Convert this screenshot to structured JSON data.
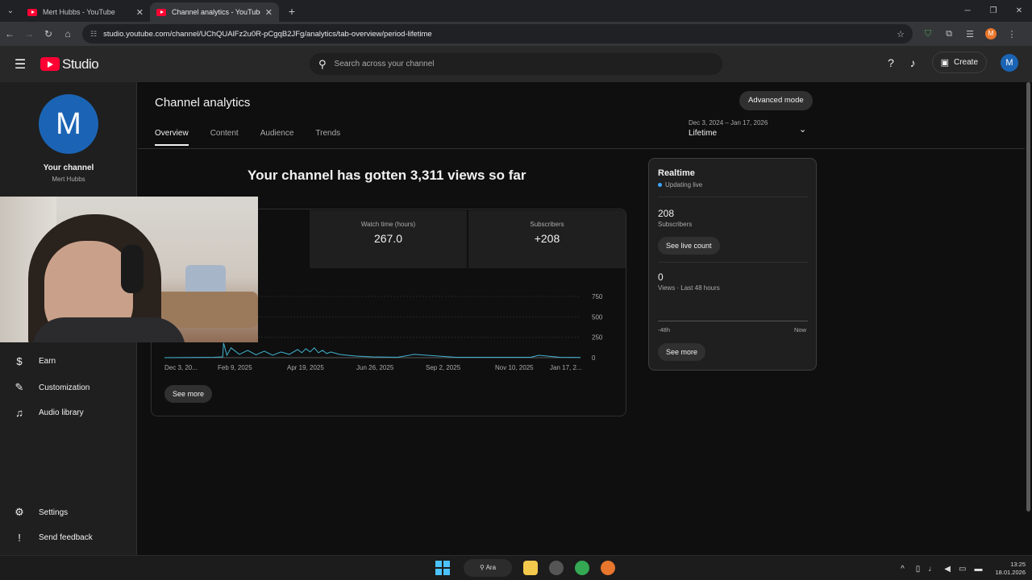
{
  "browser": {
    "tabs": [
      {
        "title": "Mert Hubbs - YouTube",
        "active": false
      },
      {
        "title": "Channel analytics - YouTube St",
        "active": true
      }
    ],
    "url": "studio.youtube.com/channel/UChQUAlFz2u0R-pCgqB2JFg/analytics/tab-overview/period-lifetime",
    "profile_initial": "M"
  },
  "header": {
    "logo_text": "Studio",
    "search_placeholder": "Search across your channel",
    "create_label": "Create",
    "avatar_initial": "M"
  },
  "sidebar": {
    "avatar_initial": "M",
    "your_channel_label": "Your channel",
    "channel_name": "Mert Hubbs",
    "items": [
      {
        "label": "Earn",
        "icon": "dollar-icon"
      },
      {
        "label": "Customization",
        "icon": "wand-icon"
      },
      {
        "label": "Audio library",
        "icon": "audio-library-icon"
      }
    ],
    "bottom_items": [
      {
        "label": "Settings",
        "icon": "gear-icon"
      },
      {
        "label": "Send feedback",
        "icon": "feedback-icon"
      }
    ]
  },
  "main": {
    "title": "Channel analytics",
    "advanced_mode_label": "Advanced mode",
    "tabs": [
      "Overview",
      "Content",
      "Audience",
      "Trends"
    ],
    "active_tab": "Overview",
    "date_range": "Dec 3, 2024 – Jan 17, 2026",
    "period": "Lifetime",
    "headline": "Your channel has gotten 3,311 views so far",
    "metrics": [
      {
        "label": "Watch time (hours)",
        "value": "267.0"
      },
      {
        "label": "Subscribers",
        "value": "+208"
      }
    ],
    "see_more_label": "See more"
  },
  "chart_data": {
    "type": "line",
    "x_tick_labels": [
      "Dec 3, 20...",
      "Feb 9, 2025",
      "Apr 19, 2025",
      "Jun 26, 2025",
      "Sep 2, 2025",
      "Nov 10, 2025",
      "Jan 17, 2..."
    ],
    "y_tick_labels": [
      "750",
      "500",
      "250",
      "0"
    ],
    "ylim": [
      0,
      750
    ],
    "series": [
      {
        "color": "#41b4d2",
        "x": [
          0,
          0.06,
          0.12,
          0.14,
          0.142,
          0.15,
          0.16,
          0.18,
          0.2,
          0.22,
          0.24,
          0.26,
          0.28,
          0.3,
          0.32,
          0.33,
          0.34,
          0.35,
          0.36,
          0.37,
          0.38,
          0.39,
          0.4,
          0.42,
          0.44,
          0.46,
          0.5,
          0.56,
          0.6,
          0.7,
          0.8,
          0.88,
          0.9,
          0.95,
          1.0
        ],
        "values": [
          0,
          2,
          5,
          10,
          180,
          30,
          120,
          40,
          90,
          35,
          80,
          30,
          70,
          40,
          100,
          60,
          110,
          70,
          120,
          60,
          90,
          50,
          70,
          40,
          30,
          20,
          10,
          5,
          40,
          5,
          5,
          5,
          30,
          5,
          3
        ]
      }
    ],
    "grid": true
  },
  "realtime": {
    "title": "Realtime",
    "status": "Updating live",
    "subscribers_value": "208",
    "subscribers_label": "Subscribers",
    "see_live_count_label": "See live count",
    "views_value": "0",
    "views_label": "Views · Last 48 hours",
    "axis_start": "-48h",
    "axis_end": "Now",
    "see_more_label": "See more"
  },
  "taskbar": {
    "search_label": "Ara",
    "time": "13:25",
    "date": "18.01.2026"
  },
  "colors": {
    "accent": "#3ea6ff",
    "line": "#41b4d2",
    "brand": "#ff0033"
  }
}
